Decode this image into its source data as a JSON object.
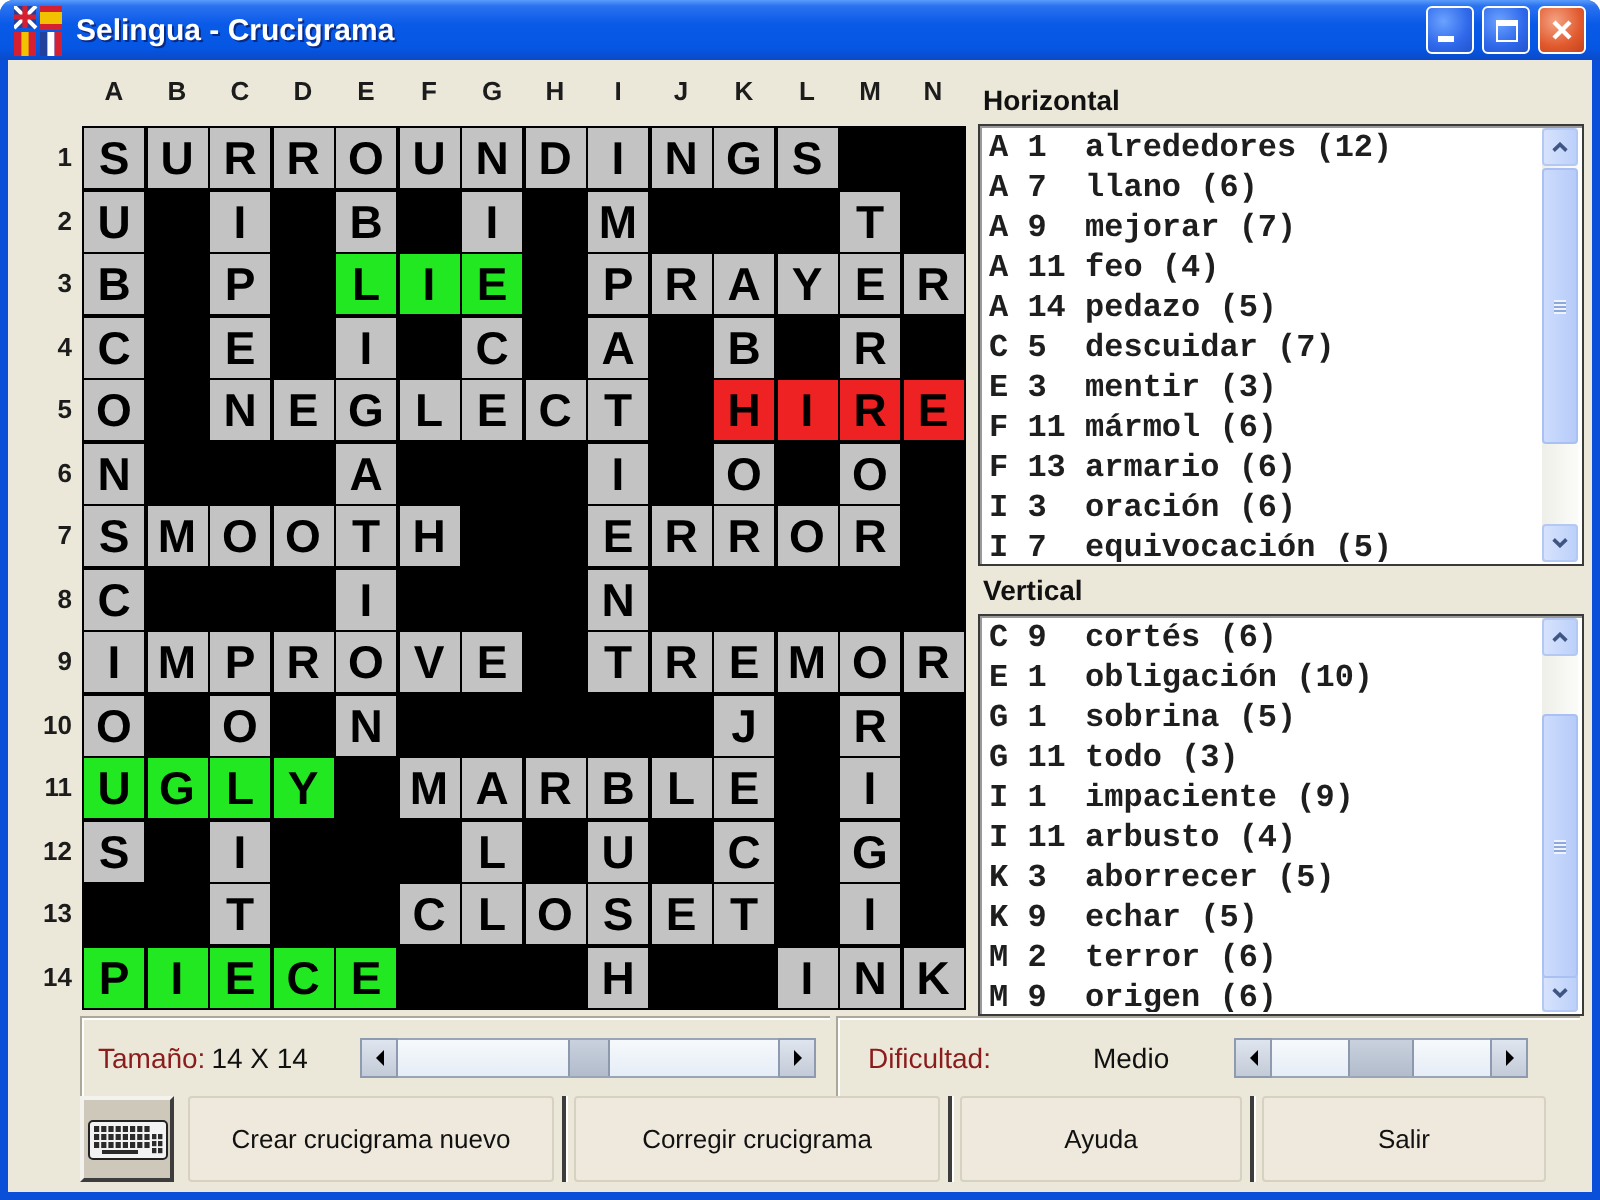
{
  "window": {
    "title": "Selingua - Crucigrama"
  },
  "grid": {
    "columns": [
      "A",
      "B",
      "C",
      "D",
      "E",
      "F",
      "G",
      "H",
      "I",
      "J",
      "K",
      "L",
      "M",
      "N"
    ],
    "rows": [
      {
        "number": "1",
        "cells": [
          {
            "kind": "letter",
            "letter": "S",
            "color": "#c3c3c3"
          },
          {
            "kind": "letter",
            "letter": "U",
            "color": "#c3c3c3"
          },
          {
            "kind": "letter",
            "letter": "R",
            "color": "#c3c3c3"
          },
          {
            "kind": "letter",
            "letter": "R",
            "color": "#c3c3c3"
          },
          {
            "kind": "letter",
            "letter": "O",
            "color": "#c3c3c3"
          },
          {
            "kind": "letter",
            "letter": "U",
            "color": "#c3c3c3"
          },
          {
            "kind": "letter",
            "letter": "N",
            "color": "#c3c3c3"
          },
          {
            "kind": "letter",
            "letter": "D",
            "color": "#c3c3c3"
          },
          {
            "kind": "letter",
            "letter": "I",
            "color": "#c3c3c3"
          },
          {
            "kind": "letter",
            "letter": "N",
            "color": "#c3c3c3"
          },
          {
            "kind": "letter",
            "letter": "G",
            "color": "#c3c3c3"
          },
          {
            "kind": "letter",
            "letter": "S",
            "color": "#c3c3c3"
          },
          {
            "kind": "block"
          },
          {
            "kind": "block"
          }
        ]
      },
      {
        "number": "2",
        "cells": [
          {
            "kind": "letter",
            "letter": "U",
            "color": "#c3c3c3"
          },
          {
            "kind": "block"
          },
          {
            "kind": "letter",
            "letter": "I",
            "color": "#c3c3c3"
          },
          {
            "kind": "block"
          },
          {
            "kind": "letter",
            "letter": "B",
            "color": "#c3c3c3"
          },
          {
            "kind": "block"
          },
          {
            "kind": "letter",
            "letter": "I",
            "color": "#c3c3c3"
          },
          {
            "kind": "block"
          },
          {
            "kind": "letter",
            "letter": "M",
            "color": "#c3c3c3"
          },
          {
            "kind": "block"
          },
          {
            "kind": "block"
          },
          {
            "kind": "block"
          },
          {
            "kind": "letter",
            "letter": "T",
            "color": "#c3c3c3"
          },
          {
            "kind": "block"
          }
        ]
      },
      {
        "number": "3",
        "cells": [
          {
            "kind": "letter",
            "letter": "B",
            "color": "#c3c3c3"
          },
          {
            "kind": "block"
          },
          {
            "kind": "letter",
            "letter": "P",
            "color": "#c3c3c3"
          },
          {
            "kind": "block"
          },
          {
            "kind": "letter",
            "letter": "L",
            "color": "#22e822"
          },
          {
            "kind": "letter",
            "letter": "I",
            "color": "#22e822"
          },
          {
            "kind": "letter",
            "letter": "E",
            "color": "#22e822"
          },
          {
            "kind": "block"
          },
          {
            "kind": "letter",
            "letter": "P",
            "color": "#c3c3c3"
          },
          {
            "kind": "letter",
            "letter": "R",
            "color": "#c3c3c3"
          },
          {
            "kind": "letter",
            "letter": "A",
            "color": "#c3c3c3"
          },
          {
            "kind": "letter",
            "letter": "Y",
            "color": "#c3c3c3"
          },
          {
            "kind": "letter",
            "letter": "E",
            "color": "#c3c3c3"
          },
          {
            "kind": "letter",
            "letter": "R",
            "color": "#c3c3c3"
          }
        ]
      },
      {
        "number": "4",
        "cells": [
          {
            "kind": "letter",
            "letter": "C",
            "color": "#c3c3c3"
          },
          {
            "kind": "block"
          },
          {
            "kind": "letter",
            "letter": "E",
            "color": "#c3c3c3"
          },
          {
            "kind": "block"
          },
          {
            "kind": "letter",
            "letter": "I",
            "color": "#c3c3c3"
          },
          {
            "kind": "block"
          },
          {
            "kind": "letter",
            "letter": "C",
            "color": "#c3c3c3"
          },
          {
            "kind": "block"
          },
          {
            "kind": "letter",
            "letter": "A",
            "color": "#c3c3c3"
          },
          {
            "kind": "block"
          },
          {
            "kind": "letter",
            "letter": "B",
            "color": "#c3c3c3"
          },
          {
            "kind": "block"
          },
          {
            "kind": "letter",
            "letter": "R",
            "color": "#c3c3c3"
          },
          {
            "kind": "block"
          }
        ]
      },
      {
        "number": "5",
        "cells": [
          {
            "kind": "letter",
            "letter": "O",
            "color": "#c3c3c3"
          },
          {
            "kind": "block"
          },
          {
            "kind": "letter",
            "letter": "N",
            "color": "#c3c3c3"
          },
          {
            "kind": "letter",
            "letter": "E",
            "color": "#c3c3c3"
          },
          {
            "kind": "letter",
            "letter": "G",
            "color": "#c3c3c3"
          },
          {
            "kind": "letter",
            "letter": "L",
            "color": "#c3c3c3"
          },
          {
            "kind": "letter",
            "letter": "E",
            "color": "#c3c3c3"
          },
          {
            "kind": "letter",
            "letter": "C",
            "color": "#c3c3c3"
          },
          {
            "kind": "letter",
            "letter": "T",
            "color": "#c3c3c3"
          },
          {
            "kind": "block"
          },
          {
            "kind": "letter",
            "letter": "H",
            "color": "#ee2222"
          },
          {
            "kind": "letter",
            "letter": "I",
            "color": "#ee2222"
          },
          {
            "kind": "letter",
            "letter": "R",
            "color": "#ee2222"
          },
          {
            "kind": "letter",
            "letter": "E",
            "color": "#ee2222"
          }
        ]
      },
      {
        "number": "6",
        "cells": [
          {
            "kind": "letter",
            "letter": "N",
            "color": "#c3c3c3"
          },
          {
            "kind": "block"
          },
          {
            "kind": "block"
          },
          {
            "kind": "block"
          },
          {
            "kind": "letter",
            "letter": "A",
            "color": "#c3c3c3"
          },
          {
            "kind": "block"
          },
          {
            "kind": "block"
          },
          {
            "kind": "block"
          },
          {
            "kind": "letter",
            "letter": "I",
            "color": "#c3c3c3"
          },
          {
            "kind": "block"
          },
          {
            "kind": "letter",
            "letter": "O",
            "color": "#c3c3c3"
          },
          {
            "kind": "block"
          },
          {
            "kind": "letter",
            "letter": "O",
            "color": "#c3c3c3"
          },
          {
            "kind": "block"
          }
        ]
      },
      {
        "number": "7",
        "cells": [
          {
            "kind": "letter",
            "letter": "S",
            "color": "#c3c3c3"
          },
          {
            "kind": "letter",
            "letter": "M",
            "color": "#c3c3c3"
          },
          {
            "kind": "letter",
            "letter": "O",
            "color": "#c3c3c3"
          },
          {
            "kind": "letter",
            "letter": "O",
            "color": "#c3c3c3"
          },
          {
            "kind": "letter",
            "letter": "T",
            "color": "#c3c3c3"
          },
          {
            "kind": "letter",
            "letter": "H",
            "color": "#c3c3c3"
          },
          {
            "kind": "block"
          },
          {
            "kind": "block"
          },
          {
            "kind": "letter",
            "letter": "E",
            "color": "#c3c3c3"
          },
          {
            "kind": "letter",
            "letter": "R",
            "color": "#c3c3c3"
          },
          {
            "kind": "letter",
            "letter": "R",
            "color": "#c3c3c3"
          },
          {
            "kind": "letter",
            "letter": "O",
            "color": "#c3c3c3"
          },
          {
            "kind": "letter",
            "letter": "R",
            "color": "#c3c3c3"
          },
          {
            "kind": "block"
          }
        ]
      },
      {
        "number": "8",
        "cells": [
          {
            "kind": "letter",
            "letter": "C",
            "color": "#c3c3c3"
          },
          {
            "kind": "block"
          },
          {
            "kind": "block"
          },
          {
            "kind": "block"
          },
          {
            "kind": "letter",
            "letter": "I",
            "color": "#c3c3c3"
          },
          {
            "kind": "block"
          },
          {
            "kind": "block"
          },
          {
            "kind": "block"
          },
          {
            "kind": "letter",
            "letter": "N",
            "color": "#c3c3c3"
          },
          {
            "kind": "block"
          },
          {
            "kind": "block"
          },
          {
            "kind": "block"
          },
          {
            "kind": "block"
          },
          {
            "kind": "block"
          }
        ]
      },
      {
        "number": "9",
        "cells": [
          {
            "kind": "letter",
            "letter": "I",
            "color": "#c3c3c3"
          },
          {
            "kind": "letter",
            "letter": "M",
            "color": "#c3c3c3"
          },
          {
            "kind": "letter",
            "letter": "P",
            "color": "#c3c3c3"
          },
          {
            "kind": "letter",
            "letter": "R",
            "color": "#c3c3c3"
          },
          {
            "kind": "letter",
            "letter": "O",
            "color": "#c3c3c3"
          },
          {
            "kind": "letter",
            "letter": "V",
            "color": "#c3c3c3"
          },
          {
            "kind": "letter",
            "letter": "E",
            "color": "#c3c3c3"
          },
          {
            "kind": "block"
          },
          {
            "kind": "letter",
            "letter": "T",
            "color": "#c3c3c3"
          },
          {
            "kind": "letter",
            "letter": "R",
            "color": "#c3c3c3"
          },
          {
            "kind": "letter",
            "letter": "E",
            "color": "#c3c3c3"
          },
          {
            "kind": "letter",
            "letter": "M",
            "color": "#c3c3c3"
          },
          {
            "kind": "letter",
            "letter": "O",
            "color": "#c3c3c3"
          },
          {
            "kind": "letter",
            "letter": "R",
            "color": "#c3c3c3"
          }
        ]
      },
      {
        "number": "10",
        "cells": [
          {
            "kind": "letter",
            "letter": "O",
            "color": "#c3c3c3"
          },
          {
            "kind": "block"
          },
          {
            "kind": "letter",
            "letter": "O",
            "color": "#c3c3c3"
          },
          {
            "kind": "block"
          },
          {
            "kind": "letter",
            "letter": "N",
            "color": "#c3c3c3"
          },
          {
            "kind": "block"
          },
          {
            "kind": "block"
          },
          {
            "kind": "block"
          },
          {
            "kind": "block"
          },
          {
            "kind": "block"
          },
          {
            "kind": "letter",
            "letter": "J",
            "color": "#c3c3c3"
          },
          {
            "kind": "block"
          },
          {
            "kind": "letter",
            "letter": "R",
            "color": "#c3c3c3"
          },
          {
            "kind": "block"
          }
        ]
      },
      {
        "number": "11",
        "cells": [
          {
            "kind": "letter",
            "letter": "U",
            "color": "#22e822"
          },
          {
            "kind": "letter",
            "letter": "G",
            "color": "#22e822"
          },
          {
            "kind": "letter",
            "letter": "L",
            "color": "#22e822"
          },
          {
            "kind": "letter",
            "letter": "Y",
            "color": "#22e822"
          },
          {
            "kind": "block"
          },
          {
            "kind": "letter",
            "letter": "M",
            "color": "#c3c3c3"
          },
          {
            "kind": "letter",
            "letter": "A",
            "color": "#c3c3c3"
          },
          {
            "kind": "letter",
            "letter": "R",
            "color": "#c3c3c3"
          },
          {
            "kind": "letter",
            "letter": "B",
            "color": "#c3c3c3"
          },
          {
            "kind": "letter",
            "letter": "L",
            "color": "#c3c3c3"
          },
          {
            "kind": "letter",
            "letter": "E",
            "color": "#c3c3c3"
          },
          {
            "kind": "block"
          },
          {
            "kind": "letter",
            "letter": "I",
            "color": "#c3c3c3"
          },
          {
            "kind": "block"
          }
        ]
      },
      {
        "number": "12",
        "cells": [
          {
            "kind": "letter",
            "letter": "S",
            "color": "#c3c3c3"
          },
          {
            "kind": "block"
          },
          {
            "kind": "letter",
            "letter": "I",
            "color": "#c3c3c3"
          },
          {
            "kind": "block"
          },
          {
            "kind": "block"
          },
          {
            "kind": "block"
          },
          {
            "kind": "letter",
            "letter": "L",
            "color": "#c3c3c3"
          },
          {
            "kind": "block"
          },
          {
            "kind": "letter",
            "letter": "U",
            "color": "#c3c3c3"
          },
          {
            "kind": "block"
          },
          {
            "kind": "letter",
            "letter": "C",
            "color": "#c3c3c3"
          },
          {
            "kind": "block"
          },
          {
            "kind": "letter",
            "letter": "G",
            "color": "#c3c3c3"
          },
          {
            "kind": "block"
          }
        ]
      },
      {
        "number": "13",
        "cells": [
          {
            "kind": "block"
          },
          {
            "kind": "block"
          },
          {
            "kind": "letter",
            "letter": "T",
            "color": "#c3c3c3"
          },
          {
            "kind": "block"
          },
          {
            "kind": "block"
          },
          {
            "kind": "letter",
            "letter": "C",
            "color": "#c3c3c3"
          },
          {
            "kind": "letter",
            "letter": "L",
            "color": "#c3c3c3"
          },
          {
            "kind": "letter",
            "letter": "O",
            "color": "#c3c3c3"
          },
          {
            "kind": "letter",
            "letter": "S",
            "color": "#c3c3c3"
          },
          {
            "kind": "letter",
            "letter": "E",
            "color": "#c3c3c3"
          },
          {
            "kind": "letter",
            "letter": "T",
            "color": "#c3c3c3"
          },
          {
            "kind": "block"
          },
          {
            "kind": "letter",
            "letter": "I",
            "color": "#c3c3c3"
          },
          {
            "kind": "block"
          }
        ]
      },
      {
        "number": "14",
        "cells": [
          {
            "kind": "letter",
            "letter": "P",
            "color": "#22e822"
          },
          {
            "kind": "letter",
            "letter": "I",
            "color": "#22e822"
          },
          {
            "kind": "letter",
            "letter": "E",
            "color": "#22e822"
          },
          {
            "kind": "letter",
            "letter": "C",
            "color": "#22e822"
          },
          {
            "kind": "letter",
            "letter": "E",
            "color": "#22e822"
          },
          {
            "kind": "block"
          },
          {
            "kind": "block"
          },
          {
            "kind": "block"
          },
          {
            "kind": "letter",
            "letter": "H",
            "color": "#c3c3c3"
          },
          {
            "kind": "block"
          },
          {
            "kind": "block"
          },
          {
            "kind": "letter",
            "letter": "I",
            "color": "#c3c3c3"
          },
          {
            "kind": "letter",
            "letter": "N",
            "color": "#c3c3c3"
          },
          {
            "kind": "letter",
            "letter": "K",
            "color": "#c3c3c3"
          }
        ]
      }
    ]
  },
  "clue_lists": [
    {
      "title": "Horizontal",
      "clues": [
        "A 1  alrededores (12)",
        "A 7  llano (6)",
        "A 9  mejorar (7)",
        "A 11 feo (4)",
        "A 14 pedazo (5)",
        "C 5  descuidar (7)",
        "E 3  mentir (3)",
        "F 11 mármol (6)",
        "F 13 armario (6)",
        "I 3  oración (6)",
        "I 7  equivocación (5)"
      ]
    },
    {
      "title": "Vertical",
      "clues": [
        "C 9  cortés (6)",
        "E 1  obligación (10)",
        "G 1  sobrina (5)",
        "G 11 todo (3)",
        "I 1  impaciente (9)",
        "I 11 arbusto (4)",
        "K 3  aborrecer (5)",
        "K 9  echar (5)",
        "M 2  terror (6)",
        "M 9  origen (6)"
      ]
    }
  ],
  "settings": [
    {
      "label": "Tamaño:",
      "value": "14 X 14",
      "level": 0.5
    },
    {
      "label": "Dificultad:",
      "value": "Medio",
      "level": 0.5
    }
  ],
  "buttons": [
    "Crear crucigrama nuevo",
    "Corregir crucigrama",
    "Ayuda",
    "Salir"
  ]
}
